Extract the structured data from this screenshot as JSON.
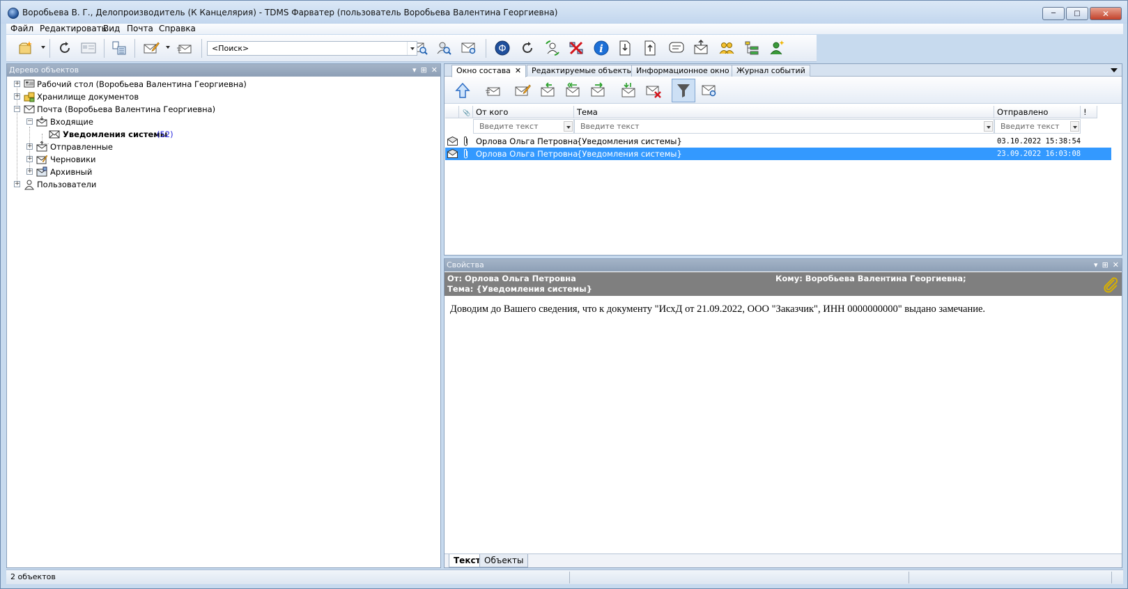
{
  "window": {
    "title": "Воробьева В. Г., Делопроизводитель (К Канцелярия) - TDMS Фарватер (пользователь Воробьева Валентина Георгиевна)"
  },
  "menu": [
    "Файл",
    "Редактировать",
    "Вид",
    "Почта",
    "Справка"
  ],
  "search": {
    "value": "<Поиск>"
  },
  "left_panel": {
    "title": "Дерево объектов",
    "tree": [
      {
        "label": "Рабочий стол (Воробьева Валентина Георгиевна)",
        "icon": "desktop-icon",
        "level": 0,
        "expander": "+"
      },
      {
        "label": "Хранилище документов",
        "icon": "storage-icon",
        "level": 0,
        "expander": "+"
      },
      {
        "label": "Почта (Воробьева Валентина Георгиевна)",
        "icon": "mail-icon",
        "level": 0,
        "expander": "-"
      },
      {
        "label": "Входящие",
        "icon": "inbox-icon",
        "level": 1,
        "expander": "-"
      },
      {
        "label": "Уведомления системы",
        "icon": "envelope-icon",
        "level": 2,
        "bold": true,
        "count": "(52)"
      },
      {
        "label": "Отправленные",
        "icon": "sent-icon",
        "level": 1,
        "expander": "+"
      },
      {
        "label": "Черновики",
        "icon": "drafts-icon",
        "level": 1,
        "expander": "+"
      },
      {
        "label": "Архивный",
        "icon": "archive-icon",
        "level": 1,
        "expander": "+"
      },
      {
        "label": "Пользователи",
        "icon": "users-icon",
        "level": 0,
        "expander": "+"
      }
    ]
  },
  "tabs": [
    "Окно состава",
    "Редактируемые объекты",
    "Информационное окно",
    "Журнал событий"
  ],
  "grid": {
    "headers": {
      "attach": "📎",
      "from": "От кого",
      "subject": "Тема",
      "sent": "Отправлено",
      "flag": "!"
    },
    "filter_placeholder": "Введите текст",
    "rows": [
      {
        "from": "Орлова Ольга Петровна",
        "subject": "{Уведомления системы}",
        "sent": "03.10.2022 15:38:54",
        "selected": false
      },
      {
        "from": "Орлова Ольга Петровна",
        "subject": "{Уведомления системы}",
        "sent": "23.09.2022 16:03:08",
        "selected": true
      }
    ]
  },
  "properties": {
    "title": "Свойства",
    "from": "От: Орлова Ольга Петровна",
    "to": "Кому: Воробьева Валентина Георгиевна;",
    "subject": "Тема: {Уведомления системы}",
    "body": "Доводим до Вашего сведения, что к документу \"ИсхД от 21.09.2022, ООО \"Заказчик\", ИНН 0000000000\" выдано замечание.",
    "bottom_tabs": [
      "Текст",
      "Объекты"
    ]
  },
  "status": {
    "text": "2 объектов"
  },
  "colors": {
    "selection": "#3399ff",
    "panel_header": "#8d9fb6",
    "count": "#2a2adf"
  }
}
